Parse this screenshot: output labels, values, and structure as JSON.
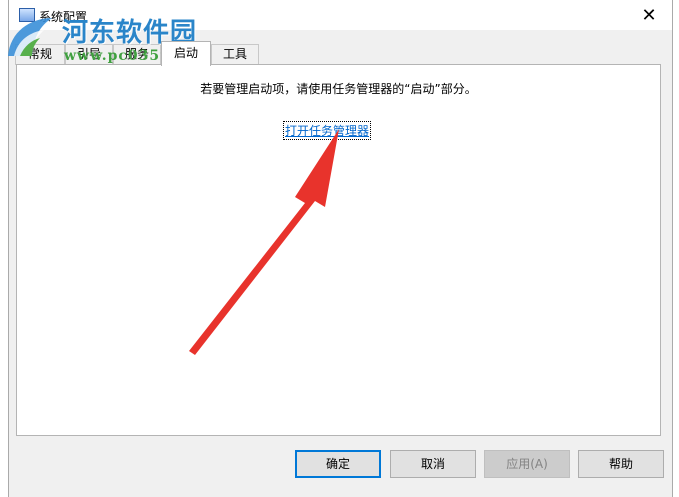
{
  "window": {
    "title": "系统配置",
    "close_label": "✕"
  },
  "watermark": {
    "title": "河东软件园",
    "url": "www.pc0359.cn"
  },
  "tabs": [
    {
      "label": "常规",
      "active": false
    },
    {
      "label": "引导",
      "active": false
    },
    {
      "label": "服务",
      "active": false
    },
    {
      "label": "启动",
      "active": true
    },
    {
      "label": "工具",
      "active": false
    }
  ],
  "panel": {
    "message": "若要管理启动项，请使用任务管理器的“启动”部分。",
    "link": "打开任务管理器"
  },
  "buttons": {
    "ok": "确定",
    "cancel": "取消",
    "apply": "应用(A)",
    "help": "帮助"
  },
  "colors": {
    "accent": "#0078d7",
    "link": "#0066cc",
    "arrow": "#e8332c"
  }
}
